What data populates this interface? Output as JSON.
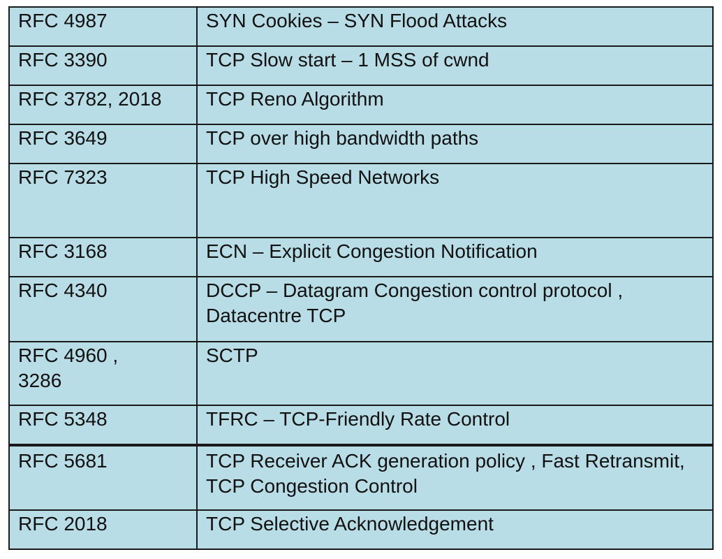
{
  "table": {
    "rows": [
      {
        "rfc": "RFC 4987",
        "desc": "SYN Cookies – SYN Flood Attacks"
      },
      {
        "rfc": "RFC 3390",
        "desc": "TCP Slow start – 1 MSS of cwnd"
      },
      {
        "rfc": "RFC 3782, 2018",
        "desc": "TCP Reno Algorithm"
      },
      {
        "rfc": "RFC 3649",
        "desc": "TCP over high bandwidth paths"
      },
      {
        "rfc": "RFC 7323",
        "desc": "TCP High Speed Networks"
      },
      {
        "rfc": "RFC 3168",
        "desc": "ECN – Explicit Congestion Notification"
      },
      {
        "rfc": "RFC 4340",
        "desc": "DCCP – Datagram Congestion control protocol , Datacentre TCP"
      },
      {
        "rfc": "RFC 4960 , 3286",
        "desc": "SCTP"
      },
      {
        "rfc": "RFC 5348",
        "desc": "TFRC – TCP-Friendly Rate Control"
      },
      {
        "rfc": "RFC 5681",
        "desc": "TCP Receiver ACK generation policy , Fast Retransmit, TCP Congestion Control"
      },
      {
        "rfc": "RFC 2018",
        "desc": "TCP Selective Acknowledgement"
      }
    ]
  }
}
